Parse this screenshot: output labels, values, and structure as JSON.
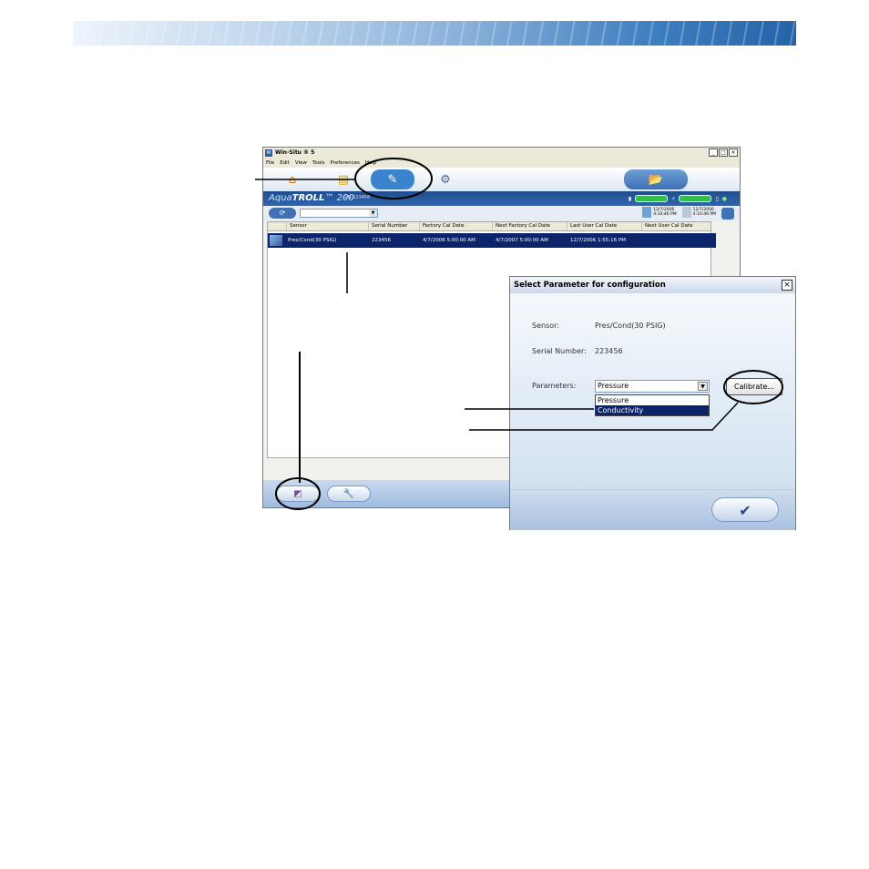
{
  "window": {
    "title": "Win-Situ ® 5",
    "menu": [
      "File",
      "Edit",
      "View",
      "Tools",
      "Preferences",
      "Help"
    ],
    "controls": {
      "minimize": "_",
      "maximize": "□",
      "close": "×"
    }
  },
  "device": {
    "brand_prefix": "Aqua",
    "brand_bold": "TROLL",
    "brand_suffix": "™ 200",
    "serial_prefix": "S/N 223456",
    "date1": "12/7/2006",
    "time1": "4:10:46 PM",
    "date2": "12/7/2006",
    "time2": "4:10:46 PM"
  },
  "table": {
    "headers": [
      "Sensor",
      "Serial Number",
      "Factory Cal Date",
      "Next Factory Cal Date",
      "Last User Cal Date",
      "Next User Cal Date"
    ],
    "rows": [
      {
        "sensor": "Pres/Cond(30 PSIG)",
        "serial": "223456",
        "factory_cal": "4/7/2006 5:00:00 AM",
        "next_factory_cal": "4/7/2007 5:00:00 AM",
        "last_user_cal": "12/7/2006 1:55:16 PM",
        "next_user_cal": ""
      }
    ]
  },
  "dialog": {
    "title": "Select Parameter for configuration",
    "close": "×",
    "sensor_label": "Sensor:",
    "sensor_value": "Pres/Cond(30 PSIG)",
    "serial_label": "Serial Number:",
    "serial_value": "223456",
    "parameters_label": "Parameters:",
    "parameters_selected": "Pressure",
    "parameters_options": [
      "Pressure",
      "Conductivity"
    ],
    "calibrate_label": "Calibrate...",
    "ok_glyph": "✔"
  },
  "colors": {
    "selection": "#0c246a",
    "device_bar": "#1e4d8c",
    "active_tab": "#3a83cf",
    "status_bar": "#30c048"
  }
}
